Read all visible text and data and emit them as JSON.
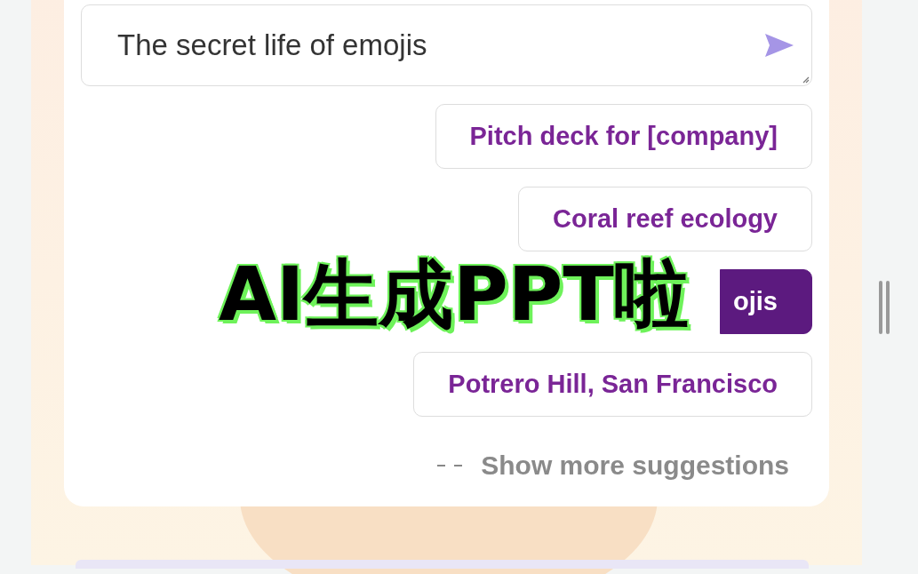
{
  "prompt": {
    "value": "The secret life of emojis"
  },
  "suggestions": [
    {
      "label": "Pitch deck for [company]",
      "selected": false
    },
    {
      "label": "Coral reef ecology",
      "selected": false
    },
    {
      "label": "ojis",
      "selected": true
    },
    {
      "label": "Potrero Hill, San Francisco",
      "selected": false
    }
  ],
  "show_more": "Show more suggestions",
  "overlay_caption": "AI生成PPT啦"
}
